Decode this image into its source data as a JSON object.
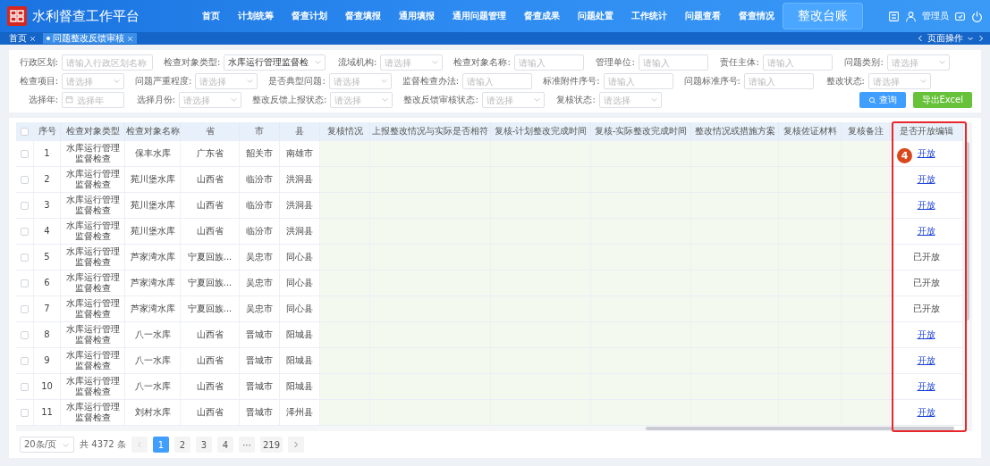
{
  "header": {
    "title": "水利督查工作平台",
    "user": "管理员",
    "nav": [
      {
        "label": "首页",
        "selected": false
      },
      {
        "label": "计划统筹",
        "selected": false
      },
      {
        "label": "督查计划",
        "selected": false
      },
      {
        "label": "督查填报",
        "selected": false
      },
      {
        "label": "通用填报",
        "selected": false
      },
      {
        "label": "通用问题管理",
        "selected": false
      },
      {
        "label": "督查成果",
        "selected": false
      },
      {
        "label": "问题处置",
        "selected": false
      },
      {
        "label": "工作统计",
        "selected": false
      },
      {
        "label": "问题查看",
        "selected": false
      },
      {
        "label": "督查情况",
        "selected": false
      },
      {
        "label": "整改台账",
        "selected": true
      }
    ]
  },
  "page_tabs": {
    "tabs": [
      {
        "label": "首页",
        "selected": false
      },
      {
        "label": "问题整改反馈审核",
        "selected": true
      }
    ],
    "actions": "页面操作"
  },
  "filter_rows": [
    {
      "fields": [
        {
          "label": "行政区划:",
          "kind": "input",
          "placeholder": "请输入行政区划名称"
        },
        {
          "label": "检查对象类型:",
          "kind": "select",
          "value": "水库运行管理监督检"
        },
        {
          "label": "流域机构:",
          "kind": "select",
          "placeholder": "请选择"
        },
        {
          "label": "检查对象名称:",
          "kind": "input",
          "placeholder": "请输入"
        },
        {
          "label": "管理单位:",
          "kind": "input",
          "placeholder": "请输入"
        },
        {
          "label": "责任主体:",
          "kind": "input",
          "placeholder": "请输入"
        },
        {
          "label": "问题类别:",
          "kind": "select",
          "placeholder": "请选择"
        }
      ]
    },
    {
      "fields": [
        {
          "label": "检查项目:",
          "kind": "select",
          "placeholder": "请选择"
        },
        {
          "label": "问题严重程度:",
          "kind": "select",
          "placeholder": "请选择"
        },
        {
          "label": "是否典型问题:",
          "kind": "select",
          "placeholder": "请选择"
        },
        {
          "label": "监督检查办法:",
          "kind": "input",
          "placeholder": "请输入"
        },
        {
          "label": "标准附件序号:",
          "kind": "input",
          "placeholder": "请输入"
        },
        {
          "label": "问题标准序号:",
          "kind": "input",
          "placeholder": "请输入"
        },
        {
          "label": "整改状态:",
          "kind": "select",
          "placeholder": "请选择"
        }
      ]
    },
    {
      "fields": [
        {
          "label": "选择年:",
          "kind": "date",
          "placeholder": "选择年"
        },
        {
          "label": "选择月份:",
          "kind": "select",
          "placeholder": "请选择"
        },
        {
          "label": "整改反馈上报状态:",
          "kind": "select",
          "placeholder": "请选择"
        },
        {
          "label": "整改反馈审核状态:",
          "kind": "select",
          "placeholder": "请选择"
        },
        {
          "label": "复核状态:",
          "kind": "select",
          "placeholder": "请选择"
        }
      ]
    }
  ],
  "filter_buttons": [
    {
      "label": "查询",
      "kind": "primary"
    },
    {
      "label": "导出Excel",
      "kind": "success"
    }
  ],
  "table": {
    "select_all_checked": false,
    "columns": [
      {
        "label": "序号",
        "kind": "fixed"
      },
      {
        "label": "检查对象类型",
        "kind": "fixed"
      },
      {
        "label": "检查对象名称",
        "kind": "fixed"
      },
      {
        "label": "省",
        "kind": "fixed"
      },
      {
        "label": "市",
        "kind": "fixed"
      },
      {
        "label": "县",
        "kind": "fixed"
      },
      {
        "label": "复核情况",
        "kind": "scroll"
      },
      {
        "label": "上报整改情况与实际是否相符",
        "kind": "scroll"
      },
      {
        "label": "复核-计划整改完成时间",
        "kind": "scroll"
      },
      {
        "label": "复核-实际整改完成时间",
        "kind": "scroll"
      },
      {
        "label": "整改情况或措施方案",
        "kind": "scroll"
      },
      {
        "label": "复核佐证材料",
        "kind": "scroll"
      },
      {
        "label": "复核备注",
        "kind": "scroll"
      },
      {
        "label": "是否开放编辑",
        "kind": "fixed"
      }
    ],
    "rows": [
      {
        "checked": false,
        "cells": [
          "1",
          "水库运行管理监督检查",
          "保丰水库",
          "广东省",
          "韶关市",
          "南雄市"
        ],
        "edit": {
          "kind": "link",
          "text": "开放"
        }
      },
      {
        "checked": false,
        "cells": [
          "2",
          "水库运行管理监督检查",
          "苑川堡水库",
          "山西省",
          "临汾市",
          "洪洞县"
        ],
        "edit": {
          "kind": "link",
          "text": "开放"
        }
      },
      {
        "checked": false,
        "cells": [
          "3",
          "水库运行管理监督检查",
          "苑川堡水库",
          "山西省",
          "临汾市",
          "洪洞县"
        ],
        "edit": {
          "kind": "link",
          "text": "开放"
        }
      },
      {
        "checked": false,
        "cells": [
          "4",
          "水库运行管理监督检查",
          "苑川堡水库",
          "山西省",
          "临汾市",
          "洪洞县"
        ],
        "edit": {
          "kind": "link",
          "text": "开放"
        }
      },
      {
        "checked": false,
        "cells": [
          "5",
          "水库运行管理监督检查",
          "芦家湾水库",
          "宁夏回族...",
          "吴忠市",
          "同心县"
        ],
        "edit": {
          "kind": "text",
          "text": "已开放"
        }
      },
      {
        "checked": false,
        "cells": [
          "6",
          "水库运行管理监督检查",
          "芦家湾水库",
          "宁夏回族...",
          "吴忠市",
          "同心县"
        ],
        "edit": {
          "kind": "text",
          "text": "已开放"
        }
      },
      {
        "checked": false,
        "cells": [
          "7",
          "水库运行管理监督检查",
          "芦家湾水库",
          "宁夏回族...",
          "吴忠市",
          "同心县"
        ],
        "edit": {
          "kind": "text",
          "text": "已开放"
        }
      },
      {
        "checked": false,
        "cells": [
          "8",
          "水库运行管理监督检查",
          "八一水库",
          "山西省",
          "晋城市",
          "阳城县"
        ],
        "edit": {
          "kind": "link",
          "text": "开放"
        }
      },
      {
        "checked": false,
        "cells": [
          "9",
          "水库运行管理监督检查",
          "八一水库",
          "山西省",
          "晋城市",
          "阳城县"
        ],
        "edit": {
          "kind": "link",
          "text": "开放"
        }
      },
      {
        "checked": false,
        "cells": [
          "10",
          "水库运行管理监督检查",
          "八一水库",
          "山西省",
          "晋城市",
          "阳城县"
        ],
        "edit": {
          "kind": "link",
          "text": "开放"
        }
      },
      {
        "checked": false,
        "cells": [
          "11",
          "水库运行管理监督检查",
          "刘村水库",
          "山西省",
          "晋城市",
          "泽州县"
        ],
        "edit": {
          "kind": "link",
          "text": "开放"
        }
      }
    ]
  },
  "annotation": {
    "number": "4"
  },
  "pagination": {
    "page_size": "20条/页",
    "total": "共 4372 条",
    "prev_disabled": true,
    "next_disabled": false,
    "pages": [
      {
        "label": "1",
        "kind": "page",
        "selected": true
      },
      {
        "label": "2",
        "kind": "page",
        "selected": false
      },
      {
        "label": "3",
        "kind": "page",
        "selected": false
      },
      {
        "label": "4",
        "kind": "page",
        "selected": false
      },
      {
        "label": "···",
        "kind": "ellipsis",
        "selected": false
      },
      {
        "label": "219",
        "kind": "page",
        "selected": false
      }
    ]
  }
}
